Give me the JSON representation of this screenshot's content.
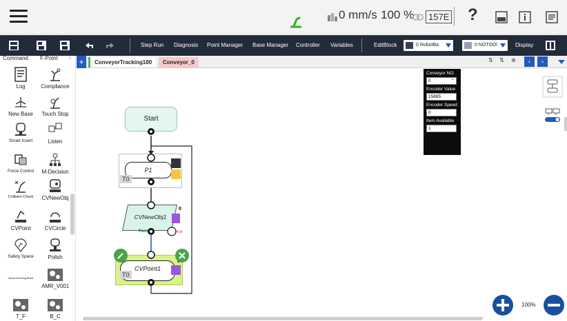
{
  "status": {
    "speed": "0 mm/s",
    "percent": "100 %",
    "counter": "157E",
    "icons": [
      "robot-arm-status-icon",
      "speed-meter-icon",
      "link-icon",
      "help-icon",
      "panel-icon",
      "info-icon",
      "log-icon"
    ]
  },
  "toolbar": {
    "step_run": "Step Run",
    "diagnosis": "Diagnosis",
    "point_manager": "Point Manager",
    "base_manager": "Base Manager",
    "controller": "Controller",
    "variables": "Variables",
    "edit_block": "EditBlock",
    "robot_dropdown": "0 RobotBa",
    "tool_dropdown": "0 NOTOOl",
    "display": "Display"
  },
  "palette": {
    "command": "Command",
    "fpoint": "F-Point",
    "items": [
      "Log",
      "Compliance",
      "New Base",
      "Touch Stop",
      "Smart Insert",
      "Listen",
      "Force Control",
      "M-Decision",
      "Collision Check",
      "CVNewObj",
      "CVPoint",
      "CVCircle",
      "Safety Space",
      "Polish",
      "Visual Servoing Block",
      "AMR_V001",
      "T_F",
      "B_C"
    ]
  },
  "tabs": {
    "add": "+",
    "project": "ConveyorTracking180",
    "conveyor": "Conveyor_0"
  },
  "flow": {
    "start": "Start",
    "p1": "P1",
    "t0_a": "T0",
    "cvnewobj": "CVNewObj1",
    "cvnew_count": "0",
    "pass": "Pass",
    "fail": "Fail",
    "cvpoint": "CVPoint1",
    "cvpoint_count": "0",
    "t0_b": "T0"
  },
  "conveyor_panel": {
    "no_label": "Conveyor NO.",
    "no_value": "0",
    "encoder_value_label": "Encoder Value",
    "encoder_value": "15885",
    "encoder_speed_label": "Encoder Speed",
    "encoder_speed": "0",
    "item_available_label": "Item Available",
    "item_available": "1"
  },
  "zoom": {
    "level": "100%"
  },
  "colors": {
    "toolbar_bg": "#232a3a",
    "accent_blue": "#2459c2",
    "start_bg": "#e4f6ee",
    "cvpoint_bg": "#d9f28a",
    "tab_conveyor_bg": "#f7c9cc"
  }
}
